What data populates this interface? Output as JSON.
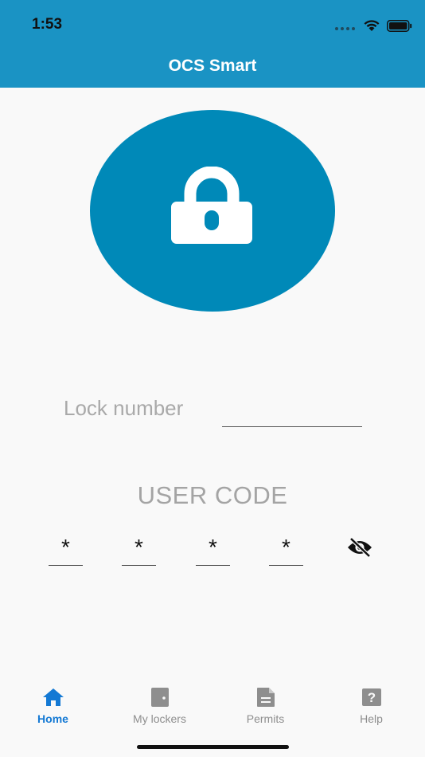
{
  "status_bar": {
    "time": "1:53"
  },
  "header": {
    "title": "OCS Smart"
  },
  "lock_number": {
    "label": "Lock number",
    "value": ""
  },
  "user_code": {
    "title": "USER CODE",
    "digits": [
      "*",
      "*",
      "*",
      "*"
    ]
  },
  "tabs": [
    {
      "label": "Home",
      "icon": "home-icon",
      "active": true
    },
    {
      "label": "My lockers",
      "icon": "door-icon",
      "active": false
    },
    {
      "label": "Permits",
      "icon": "document-icon",
      "active": false
    },
    {
      "label": "Help",
      "icon": "question-icon",
      "active": false
    }
  ],
  "colors": {
    "header": "#1a93c4",
    "lock_circle": "#0089b8",
    "tab_active": "#1479d4",
    "tab_inactive": "#8e8e8e"
  }
}
